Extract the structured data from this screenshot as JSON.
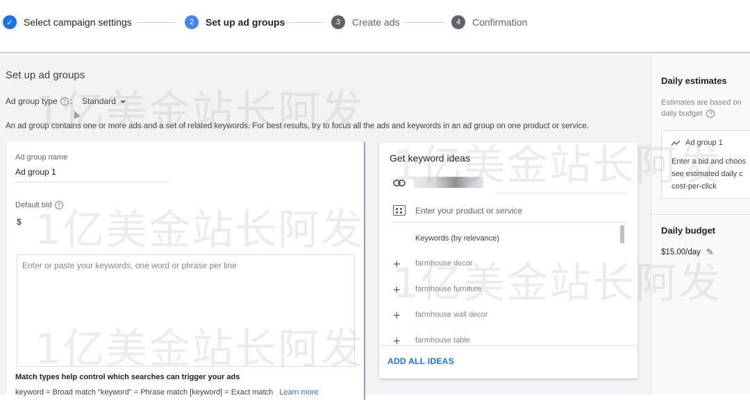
{
  "stepper": {
    "steps": [
      {
        "num": "✓",
        "label": "Select campaign settings",
        "state": "done"
      },
      {
        "num": "2",
        "label": "Set up ad groups",
        "state": "active"
      },
      {
        "num": "3",
        "label": "Create ads",
        "state": "pending"
      },
      {
        "num": "4",
        "label": "Confirmation",
        "state": "pending"
      }
    ]
  },
  "main": {
    "title": "Set up ad groups",
    "ad_group_type_label": "Ad group type",
    "ad_group_type_colon": ":",
    "ad_group_type_value": "Standard",
    "description": "An ad group contains one or more ads and a set of related keywords. For best results, try to focus all the ads and keywords in an ad group on one product or service.",
    "ad_group_name_label": "Ad group name",
    "ad_group_name_value": "Ad group 1",
    "default_bid_label": "Default bid",
    "currency_symbol": "$",
    "keywords_placeholder": "Enter or paste your keywords, one word or phrase per line",
    "match_types_title": "Match types help control which searches can trigger your ads",
    "match_types_desc": "keyword = Broad match  \"keyword\" = Phrase match  [keyword] = Exact match",
    "learn_more": "Learn more"
  },
  "ideas": {
    "title": "Get keyword ideas",
    "product_placeholder": "Enter your product or service",
    "keywords_header": "Keywords (by relevance)",
    "items": [
      "farmhouse decor",
      "farmhouse furniture",
      "farmhouse wall decor",
      "farmhouse table"
    ],
    "add_all": "ADD ALL IDEAS"
  },
  "right_panel": {
    "daily_estimates_title": "Daily estimates",
    "note_line1": "Estimates are based on",
    "note_line2": "daily budget",
    "card_ad_group": "Ad group 1",
    "card_line1": "Enter a bid and choos",
    "card_line2": "see estimated daily c",
    "card_line3": "cost-per-click",
    "daily_budget_title": "Daily budget",
    "daily_budget_value": "$15.00/day"
  },
  "watermark": "1亿美金站长阿发",
  "colors": {
    "accent": "#1a73e8",
    "active_step": "#4285f4",
    "pending_step": "#5f6368"
  }
}
